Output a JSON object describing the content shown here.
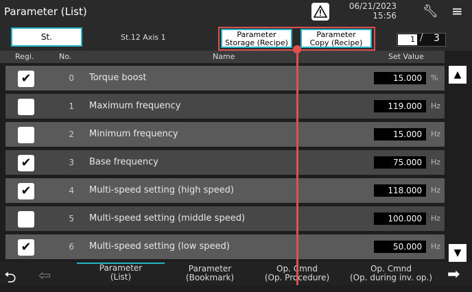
{
  "header": {
    "title": "Parameter (List)",
    "date": "06/21/2023",
    "time": "15:56"
  },
  "subheader": {
    "st_label": "St.",
    "axis_label": "St.12  Axis 1",
    "storage_btn": "Parameter\nStorage (Recipe)",
    "copy_btn": "Parameter\nCopy (Recipe)",
    "page_current": "1",
    "page_separator": "/",
    "page_total": "3"
  },
  "columns": {
    "regi": "Regi.",
    "no": "No.",
    "name": "Name",
    "value": "Set Value"
  },
  "rows": [
    {
      "checked": true,
      "check_glyph": "✔",
      "no": "0",
      "name": "Torque boost",
      "value": "15.000",
      "unit": "%"
    },
    {
      "checked": false,
      "check_glyph": "",
      "no": "1",
      "name": "Maximum frequency",
      "value": "119.000",
      "unit": "Hz"
    },
    {
      "checked": false,
      "check_glyph": "",
      "no": "2",
      "name": "Minimum frequency",
      "value": "15.000",
      "unit": "Hz"
    },
    {
      "checked": true,
      "check_glyph": "✔",
      "no": "3",
      "name": "Base frequency",
      "value": "75.000",
      "unit": "Hz"
    },
    {
      "checked": true,
      "check_glyph": "✔",
      "no": "4",
      "name": "Multi-speed setting (high speed)",
      "value": "118.000",
      "unit": "Hz"
    },
    {
      "checked": false,
      "check_glyph": "",
      "no": "5",
      "name": "Multi-speed setting (middle speed)",
      "value": "100.000",
      "unit": "Hz"
    },
    {
      "checked": true,
      "check_glyph": "✔",
      "no": "6",
      "name": "Multi-speed setting (low speed)",
      "value": "50.000",
      "unit": "Hz"
    }
  ],
  "footer": {
    "tabs": [
      {
        "label": "Parameter\n(List)"
      },
      {
        "label": "Parameter\n(Bookmark)"
      },
      {
        "label": "Op. Cmnd\n(Op. Procedure)"
      },
      {
        "label": "Op. Cmnd\n(Op. during inv. op.)"
      }
    ]
  },
  "icons": {
    "warning": "warning-triangle-icon",
    "settings": "wrench-icon",
    "menu": "hamburger-menu-icon",
    "back": "return-arrow-icon",
    "prev": "left-arrow-icon",
    "next": "right-arrow-icon",
    "scroll_up": "up-triangle-icon",
    "scroll_down": "down-triangle-icon"
  },
  "colors": {
    "accent": "#26b4c4",
    "highlight": "#e05050",
    "row_odd": "#5a5a5a",
    "row_even": "#474747"
  }
}
